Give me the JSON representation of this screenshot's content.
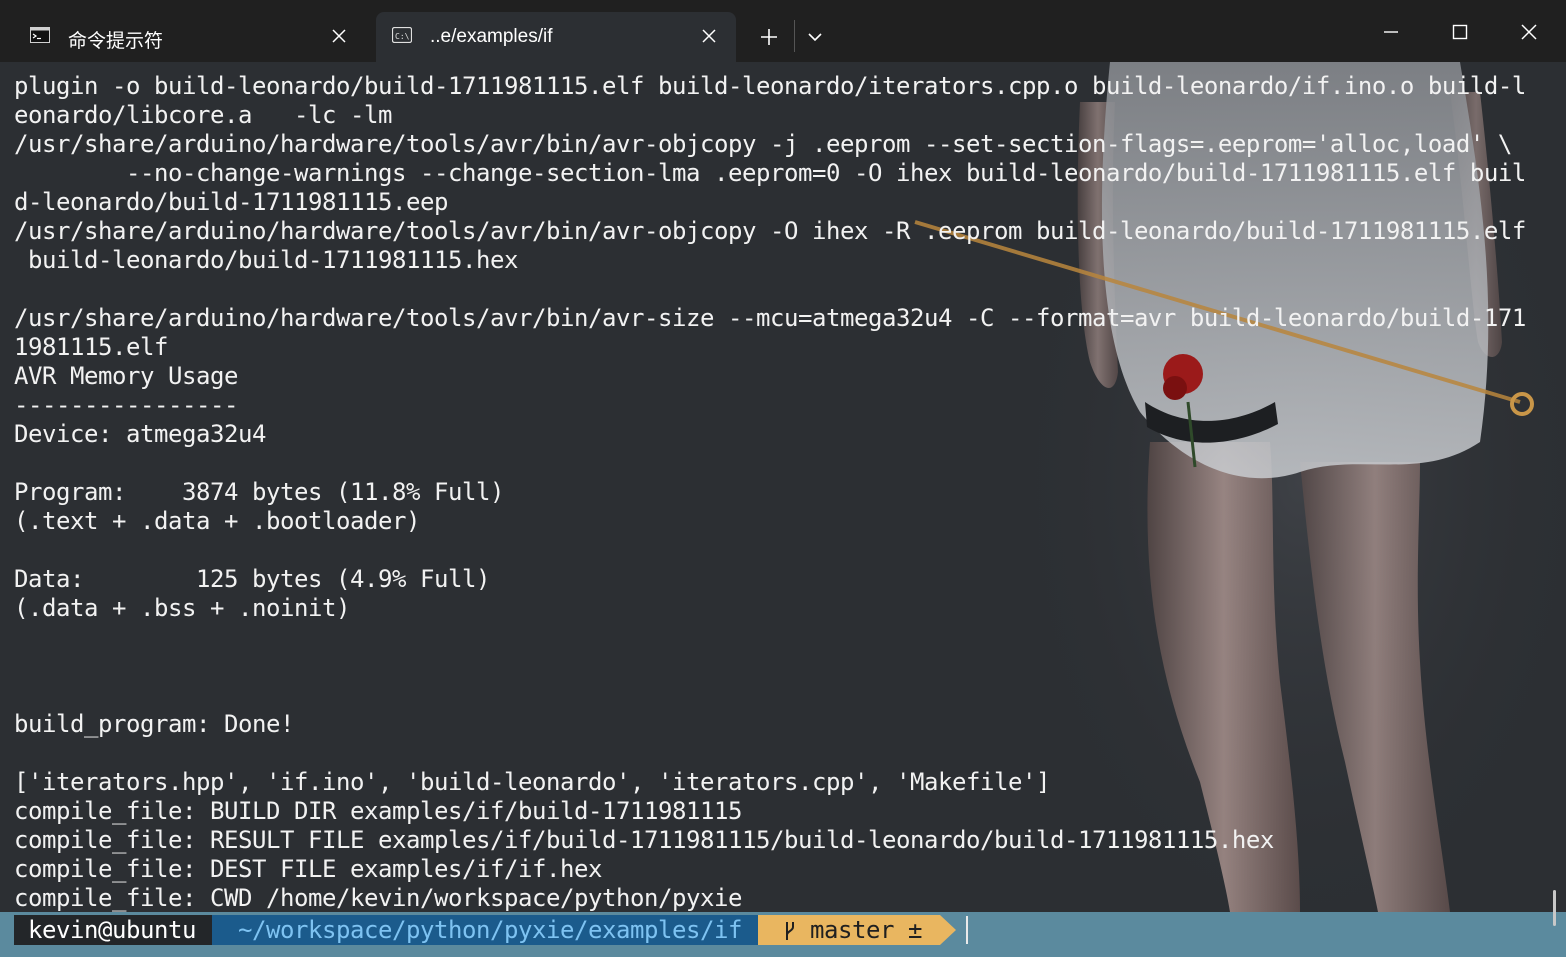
{
  "tabs": [
    {
      "label": "命令提示符",
      "icon": "cmd-icon",
      "active": false
    },
    {
      "label": "..e/examples/if",
      "icon": "cmd-icon",
      "active": true
    }
  ],
  "window_controls": {
    "minimize": "minimize-icon",
    "maximize": "maximize-icon",
    "close": "close-icon"
  },
  "terminal": {
    "lines": [
      "plugin -o build-leonardo/build-1711981115.elf build-leonardo/iterators.cpp.o build-leonardo/if.ino.o build-l",
      "eonardo/libcore.a   -lc -lm",
      "/usr/share/arduino/hardware/tools/avr/bin/avr-objcopy -j .eeprom --set-section-flags=.eeprom='alloc,load' \\",
      "        --no-change-warnings --change-section-lma .eeprom=0 -O ihex build-leonardo/build-1711981115.elf buil",
      "d-leonardo/build-1711981115.eep",
      "/usr/share/arduino/hardware/tools/avr/bin/avr-objcopy -O ihex -R .eeprom build-leonardo/build-1711981115.elf",
      " build-leonardo/build-1711981115.hex",
      "",
      "/usr/share/arduino/hardware/tools/avr/bin/avr-size --mcu=atmega32u4 -C --format=avr build-leonardo/build-171",
      "1981115.elf",
      "AVR Memory Usage",
      "----------------",
      "Device: atmega32u4",
      "",
      "Program:    3874 bytes (11.8% Full)",
      "(.text + .data + .bootloader)",
      "",
      "Data:        125 bytes (4.9% Full)",
      "(.data + .bss + .noinit)",
      "",
      "",
      "",
      "build_program: Done!",
      "",
      "['iterators.hpp', 'if.ino', 'build-leonardo', 'iterators.cpp', 'Makefile']",
      "compile_file: BUILD DIR examples/if/build-1711981115",
      "compile_file: RESULT FILE examples/if/build-1711981115/build-leonardo/build-1711981115.hex",
      "compile_file: DEST FILE examples/if/if.hex",
      "compile_file: CWD /home/kevin/workspace/python/pyxie"
    ]
  },
  "prompt": {
    "user": "kevin@ubuntu",
    "path": "~/workspace/python/pyxie/examples/if",
    "branch": "master ±",
    "branch_icon": "git-branch-icon"
  },
  "colors": {
    "terminal_bg": "#2c2f33",
    "prompt_bar": "#5b8a9e",
    "user_segment": "#232629",
    "path_segment": "#1b5b8c",
    "git_segment": "#e9b660"
  }
}
